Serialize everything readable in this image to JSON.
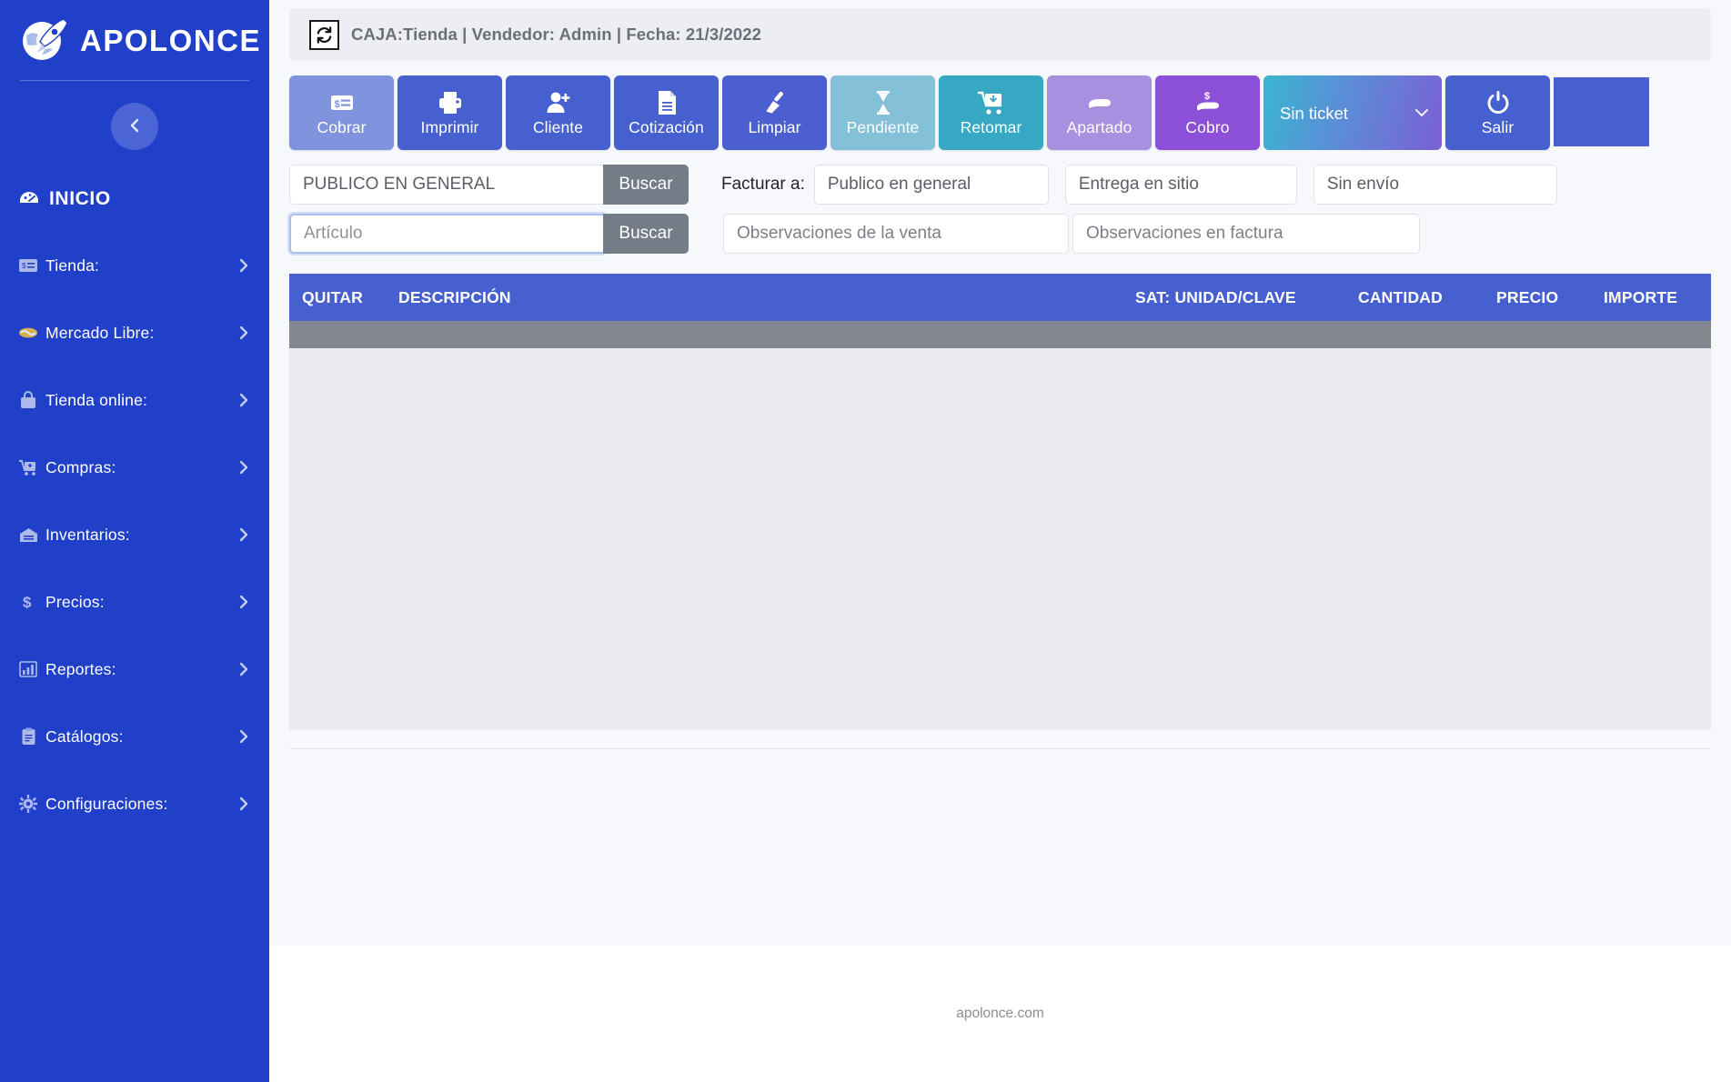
{
  "sidebar": {
    "brand": {
      "name": "APOLONCE",
      "logo_icon": "rocket-globe-icon"
    },
    "collapse": {
      "icon": "chevron-left-icon"
    },
    "home": {
      "label": "INICIO",
      "icon": "dashboard-icon"
    },
    "items": [
      {
        "label": "Tienda:",
        "icon": "cash-register-icon",
        "chevron": "chevron-right-icon"
      },
      {
        "label": "Mercado Libre:",
        "icon": "handshake-icon",
        "chevron": "chevron-right-icon"
      },
      {
        "label": "Tienda online:",
        "icon": "shopping-bag-icon",
        "chevron": "chevron-right-icon"
      },
      {
        "label": "Compras:",
        "icon": "cart-plus-icon",
        "chevron": "chevron-right-icon"
      },
      {
        "label": "Inventarios:",
        "icon": "warehouse-icon",
        "chevron": "chevron-right-icon"
      },
      {
        "label": "Precios:",
        "icon": "dollar-icon",
        "chevron": "chevron-right-icon"
      },
      {
        "label": "Reportes:",
        "icon": "bar-chart-icon",
        "chevron": "chevron-right-icon"
      },
      {
        "label": "Catálogos:",
        "icon": "clipboard-icon",
        "chevron": "chevron-right-icon"
      },
      {
        "label": "Configuraciones:",
        "icon": "gear-icon",
        "chevron": "chevron-right-icon"
      }
    ]
  },
  "topbar": {
    "refresh_icon": "refresh-icon",
    "text": "CAJA:Tienda | Vendedor: Admin | Fecha: 21/3/2022"
  },
  "toolbar": {
    "buttons": [
      {
        "label": "Cobrar",
        "icon": "cash-note-icon",
        "color": "#8093de"
      },
      {
        "label": "Imprimir",
        "icon": "printer-icon",
        "color": "#4760cf"
      },
      {
        "label": "Cliente",
        "icon": "user-plus-icon",
        "color": "#4760cf"
      },
      {
        "label": "Cotización",
        "icon": "document-icon",
        "color": "#4760cf"
      },
      {
        "label": "Limpiar",
        "icon": "broom-icon",
        "color": "#4b5fd1"
      },
      {
        "label": "Pendiente",
        "icon": "hourglass-icon",
        "color": "#85c0d9"
      },
      {
        "label": "Retomar",
        "icon": "cart-down-icon",
        "color": "#36a8c4"
      },
      {
        "label": "Apartado",
        "icon": "hand-hold-icon",
        "color": "#a98fe0"
      },
      {
        "label": "Cobro",
        "icon": "hand-money-icon",
        "color": "#8b4fd8"
      }
    ],
    "ticket_select": {
      "value": "Sin ticket",
      "chevron": "chevron-down-icon"
    },
    "exit": {
      "label": "Salir",
      "icon": "power-icon",
      "color": "#4760cf"
    },
    "blank_panel": {
      "color": "#4760cf"
    }
  },
  "search": {
    "client": {
      "value": "PUBLICO EN GENERAL",
      "button": "Buscar"
    },
    "article": {
      "value": "",
      "placeholder": "Artículo",
      "button": "Buscar"
    }
  },
  "billing": {
    "label": "Facturar a:",
    "fields": [
      {
        "value": "Publico en general"
      },
      {
        "value": "Entrega en sitio"
      },
      {
        "value": "Sin envío"
      }
    ],
    "observations": [
      {
        "placeholder": "Observaciones de la venta",
        "value": ""
      },
      {
        "placeholder": "Observaciones en factura",
        "value": ""
      }
    ]
  },
  "table": {
    "columns": [
      "QUITAR",
      "DESCRIPCIÓN",
      "SAT: UNIDAD/CLAVE",
      "CANTIDAD",
      "PRECIO",
      "IMPORTE"
    ],
    "rows": []
  },
  "footer": {
    "text": "apolonce.com"
  },
  "colors": {
    "sidebar_bg": "#2140ca",
    "primary": "#4760cf",
    "header_bg": "#eceef3",
    "table_header": "#4760cf",
    "table_strip": "#83858f",
    "page_bg": "#f7f8fc"
  }
}
